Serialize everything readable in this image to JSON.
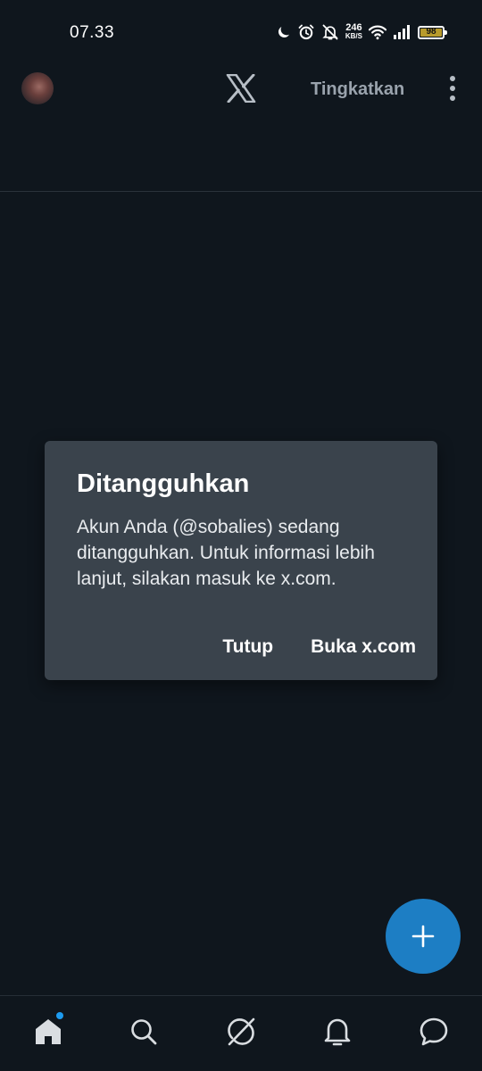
{
  "status_bar": {
    "time": "07.33",
    "net_speed_value": "246",
    "net_speed_unit": "KB/S",
    "battery_level": "98",
    "icons": [
      "moon-icon",
      "alarm-icon",
      "bell-muted-icon",
      "wifi-icon",
      "signal-icon",
      "battery-icon"
    ]
  },
  "header": {
    "logo": "x-logo-icon",
    "upgrade_label": "Tingkatkan",
    "more_icon": "more-vertical-icon"
  },
  "dialog": {
    "title": "Ditangguhkan",
    "body": "Akun Anda (@sobalies) sedang ditangguhkan. Untuk informasi lebih lanjut, silakan masuk ke x.com.",
    "close_label": "Tutup",
    "open_label": "Buka x.com"
  },
  "fab": {
    "icon": "plus-icon",
    "color": "#1d7ec4"
  },
  "bottom_nav": {
    "items": [
      "home-icon",
      "search-icon",
      "grok-icon",
      "bell-icon",
      "chat-icon"
    ],
    "active": "home-icon",
    "notification_dot_color": "#1d9bf0"
  },
  "colors": {
    "background": "#0f161d",
    "dialog": "#3a434c",
    "accent": "#1d7ec4"
  }
}
